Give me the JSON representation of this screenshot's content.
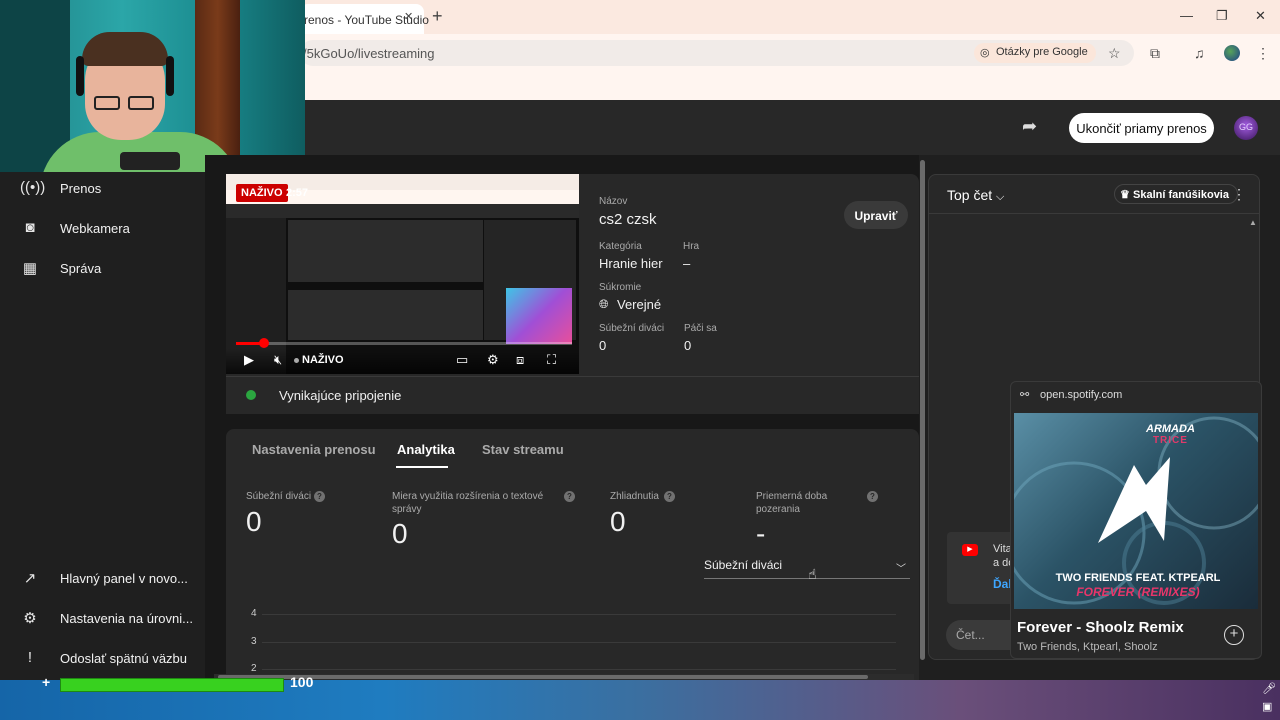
{
  "browser": {
    "tab_title": "renos - YouTube Studio",
    "tab_close": "✕",
    "new_tab": "+",
    "url": "/5kGoUo/livestreaming",
    "lens_label": "Otázky pre Google",
    "window_controls": [
      "—",
      "❐",
      "✕"
    ]
  },
  "header": {
    "end_stream_label": "Ukončiť priamy prenos",
    "avatar_text": "GG"
  },
  "sidebar": {
    "top_items": [
      {
        "label": "Prenos",
        "icon": "broadcast-icon"
      },
      {
        "label": "Webkamera",
        "icon": "camera-icon"
      },
      {
        "label": "Správa",
        "icon": "calendar-icon"
      }
    ],
    "bottom_items": [
      {
        "label": "Hlavný panel v novo...",
        "icon": "open-external-icon"
      },
      {
        "label": "Nastavenia na úrovni...",
        "icon": "gear-icon"
      },
      {
        "label": "Odoslať spätnú väzbu",
        "icon": "feedback-icon"
      }
    ]
  },
  "stream": {
    "live_badge": "NAŽIVO",
    "elapsed": "2:57",
    "player_live_label": "NAŽIVO",
    "progress": 0.08,
    "title_label": "Názov",
    "title": "cs2 czsk",
    "category_label": "Kategória",
    "category": "Hranie hier",
    "game_label": "Hra",
    "game": "–",
    "privacy_label": "Súkromie",
    "privacy": "Verejné",
    "concurrent_label": "Súbežní diváci",
    "concurrent": "0",
    "likes_label": "Páči sa",
    "likes": "0",
    "edit_label": "Upraviť",
    "connection": "Vynikajúce pripojenie",
    "connection_color": "#2ba640"
  },
  "analytics": {
    "tabs": [
      "Nastavenia prenosu",
      "Analytika",
      "Stav streamu"
    ],
    "active_tab": "Analytika",
    "metrics": [
      {
        "label": "Súbežní diváci",
        "value": "0"
      },
      {
        "label": "Miera využitia rozšírenia o textové správy",
        "value": "0"
      },
      {
        "label": "Zhliadnutia",
        "value": "0"
      },
      {
        "label": "Priemerná doba pozerania",
        "value": "-"
      }
    ],
    "dropdown_value": "Súbežní diváci",
    "y_ticks": [
      "4",
      "3",
      "2"
    ]
  },
  "chat": {
    "mode": "Top čet",
    "superfans_label": "Skalní fanúšikovia",
    "welcome_text": "Vita a do",
    "welcome_link": "Ďal",
    "input_placeholder": "Čet..."
  },
  "media": {
    "source": "open.spotify.com",
    "album_brand": "ARMADA",
    "album_brand_sub": "TRICE",
    "album_artist": "TWO FRIENDS FEAT. KTPEARL",
    "album_title": "FOREVER (REMIXES)",
    "track_title": "Forever - Shoolz Remix",
    "track_artists": "Two Friends, Ktpearl, Shoolz"
  },
  "game_hud": {
    "hp": "100"
  },
  "colors": {
    "accent_red": "#cc0000",
    "live_green": "#2ba640",
    "link_blue": "#3ea6ff"
  }
}
